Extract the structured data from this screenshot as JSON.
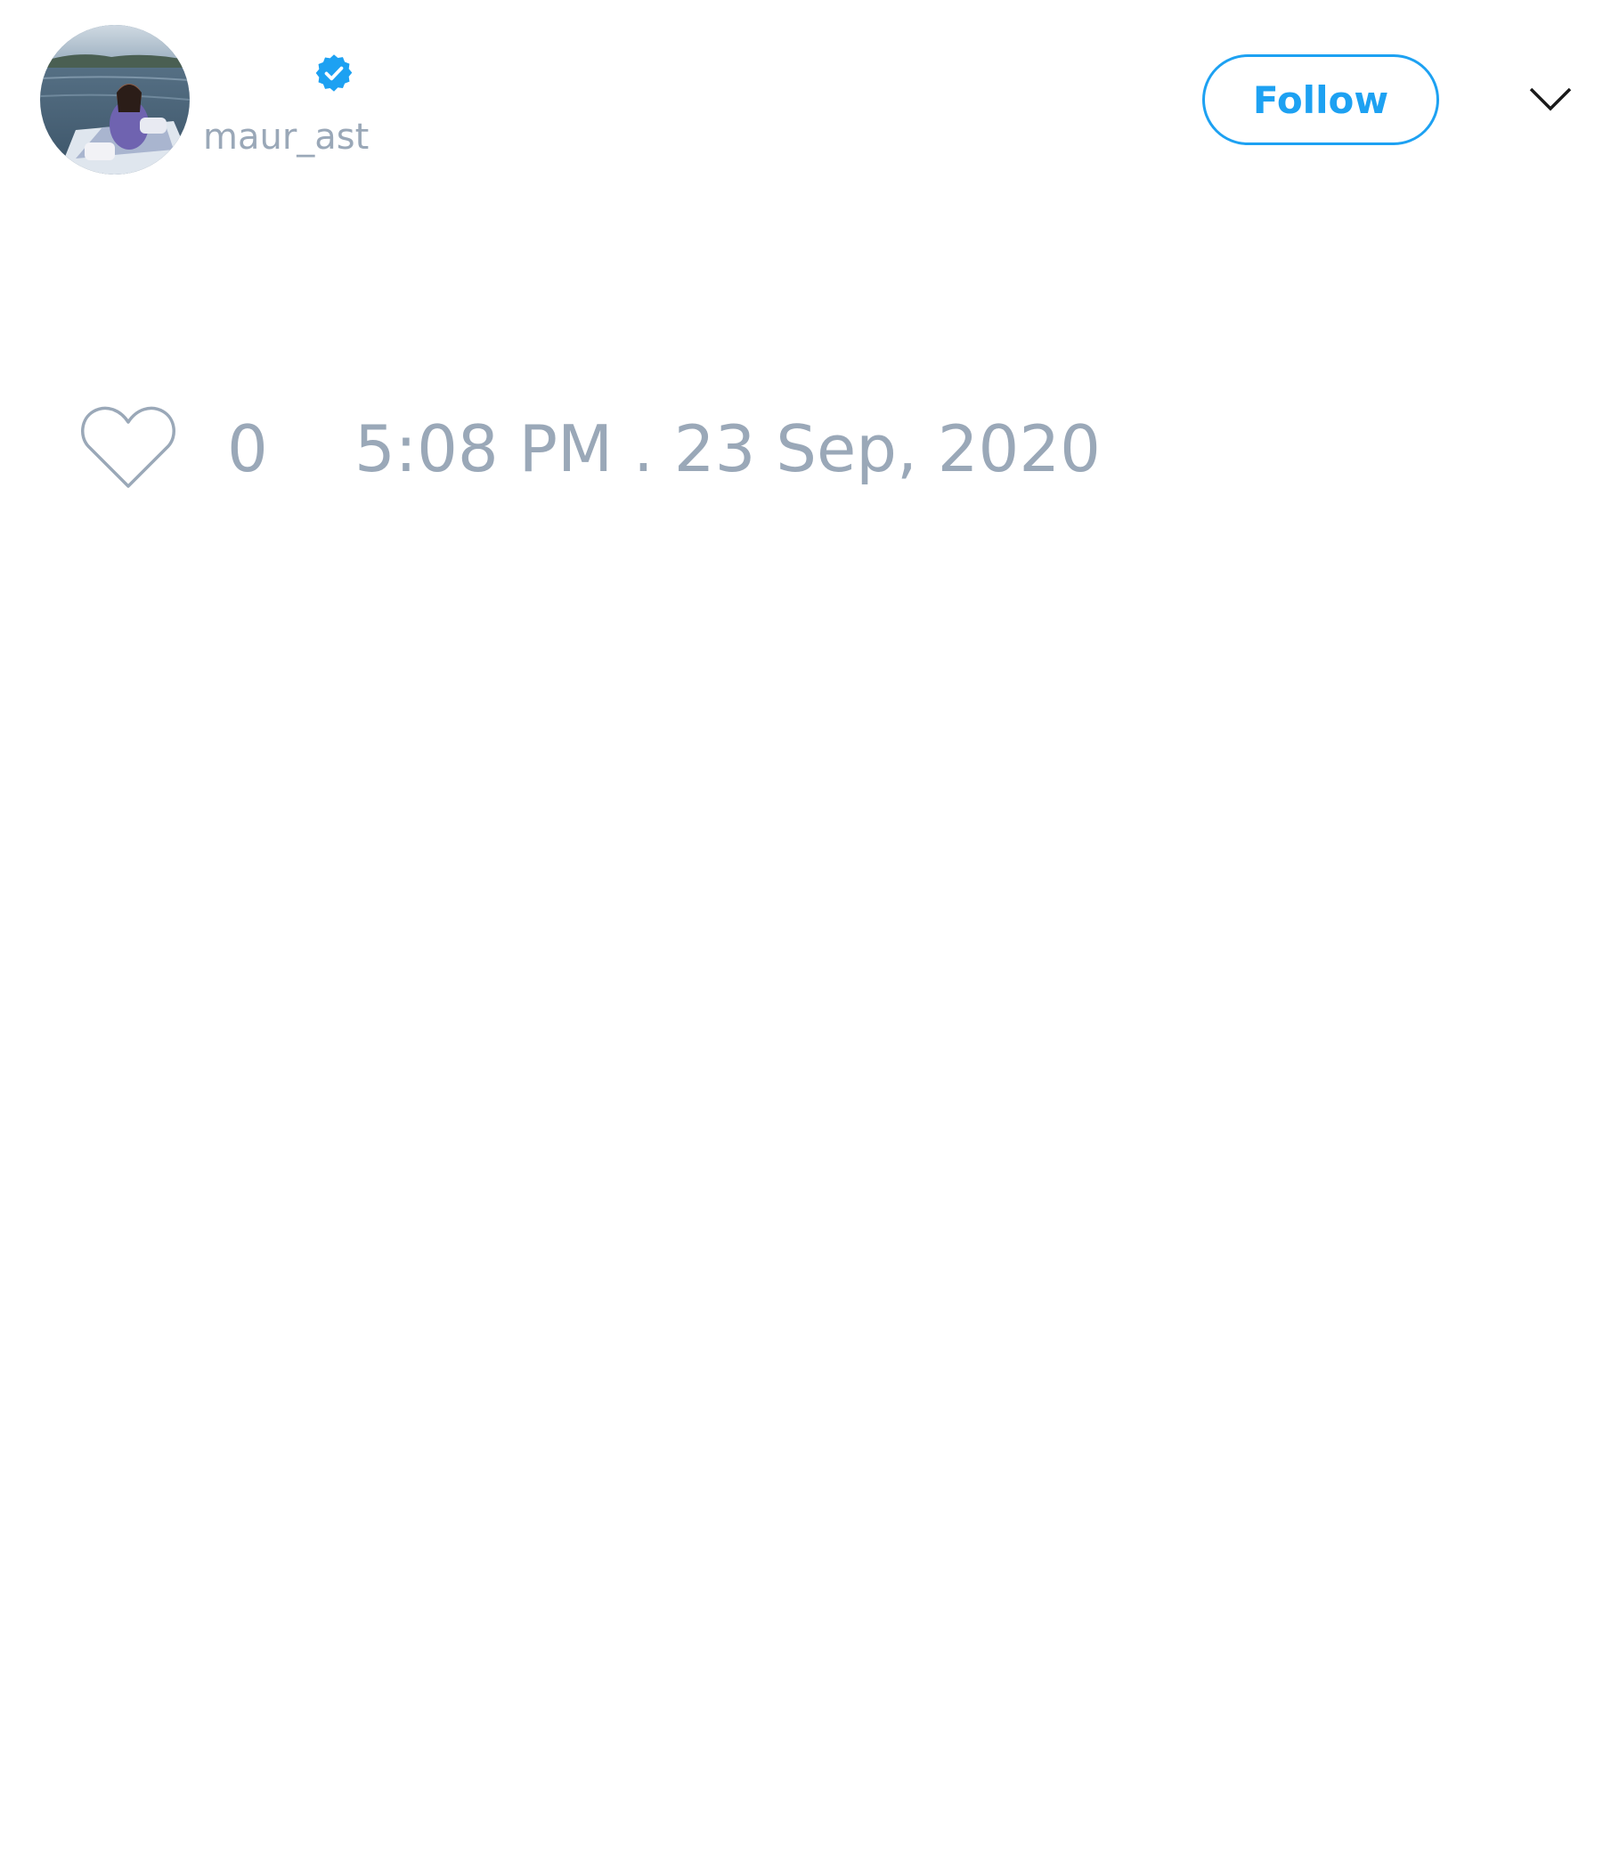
{
  "author": {
    "display_name": "",
    "handle": "maur_ast",
    "verified": true,
    "avatar_icon": "profile-photo-boat-on-lake"
  },
  "actions": {
    "follow_label": "Follow",
    "menu_icon": "chevron-down-icon"
  },
  "engagement": {
    "like_icon": "heart-outline-icon",
    "like_count": "0",
    "timestamp": "5:08 PM . 23 Sep, 2020"
  },
  "colors": {
    "accent": "#1da1f2",
    "muted_text": "#9aa8b8",
    "background": "#ffffff"
  }
}
